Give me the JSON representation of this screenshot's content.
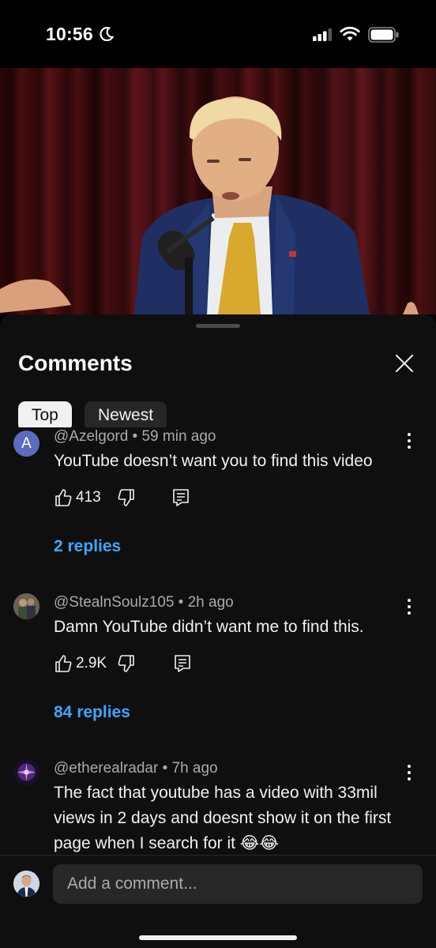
{
  "status_bar": {
    "time": "10:56",
    "icons": [
      "moon-icon",
      "signal-icon",
      "wifi-icon",
      "battery-icon"
    ]
  },
  "video": {
    "icon": "video-thumbnail"
  },
  "sheet": {
    "title": "Comments",
    "close_icon": "close-icon",
    "tabs": [
      {
        "label": "Top",
        "selected": true
      },
      {
        "label": "Newest",
        "selected": false
      }
    ]
  },
  "comments": [
    {
      "avatar_letter": "A",
      "avatar_color": "#5c6bc0",
      "meta": "@Azelgord • 59 min ago",
      "text": "YouTube doesn’t want you to find this video",
      "likes": "413",
      "replies": "2 replies"
    },
    {
      "avatar_color": "#6b5a4a",
      "meta": "@StealnSoulz105 • 2h ago",
      "text": "Damn YouTube didn’t want me to find this.",
      "likes": "2.9K",
      "replies": "84 replies"
    },
    {
      "avatar_color": "#4b2a7a",
      "meta": "@etherealradar • 7h ago",
      "text": "The fact that youtube has a video with 33mil views in 2 days and doesnt show it on the first page when I search for it 😂😂"
    }
  ],
  "add_comment": {
    "placeholder": "Add a comment..."
  },
  "colors": {
    "background": "#0f0f0f",
    "link": "#3ea6ff",
    "secondary_text": "#aaaaaa"
  }
}
